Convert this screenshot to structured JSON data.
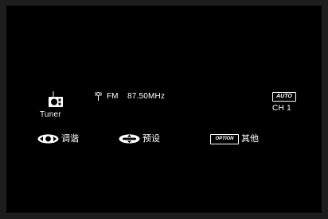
{
  "source": {
    "label": "Tuner",
    "icon": "radio-icon"
  },
  "tuner": {
    "antenna_icon": "antenna-icon",
    "band": "FM",
    "frequency": "87.50MHz"
  },
  "mode": {
    "auto_badge": "AUTO",
    "channel": "CH 1"
  },
  "actions": [
    {
      "icon": "joystick-left-right-icon",
      "label": "调谐"
    },
    {
      "icon": "joystick-up-down-icon",
      "label": "预设"
    },
    {
      "icon": "option-button-icon",
      "badge": "OPTION",
      "label": "其他"
    }
  ]
}
